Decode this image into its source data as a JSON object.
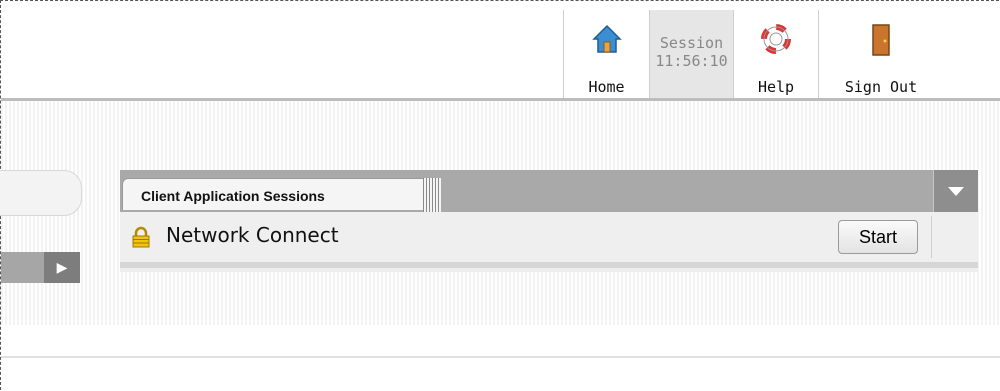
{
  "nav": {
    "home_label": "Home",
    "session_label": "Session",
    "session_time": "11:56:10",
    "help_label": "Help",
    "signout_label": "Sign Out"
  },
  "panel": {
    "tab_label": "Client Application Sessions",
    "rows": [
      {
        "label": "Network Connect",
        "button": "Start",
        "icon": "lock-icon"
      }
    ]
  }
}
